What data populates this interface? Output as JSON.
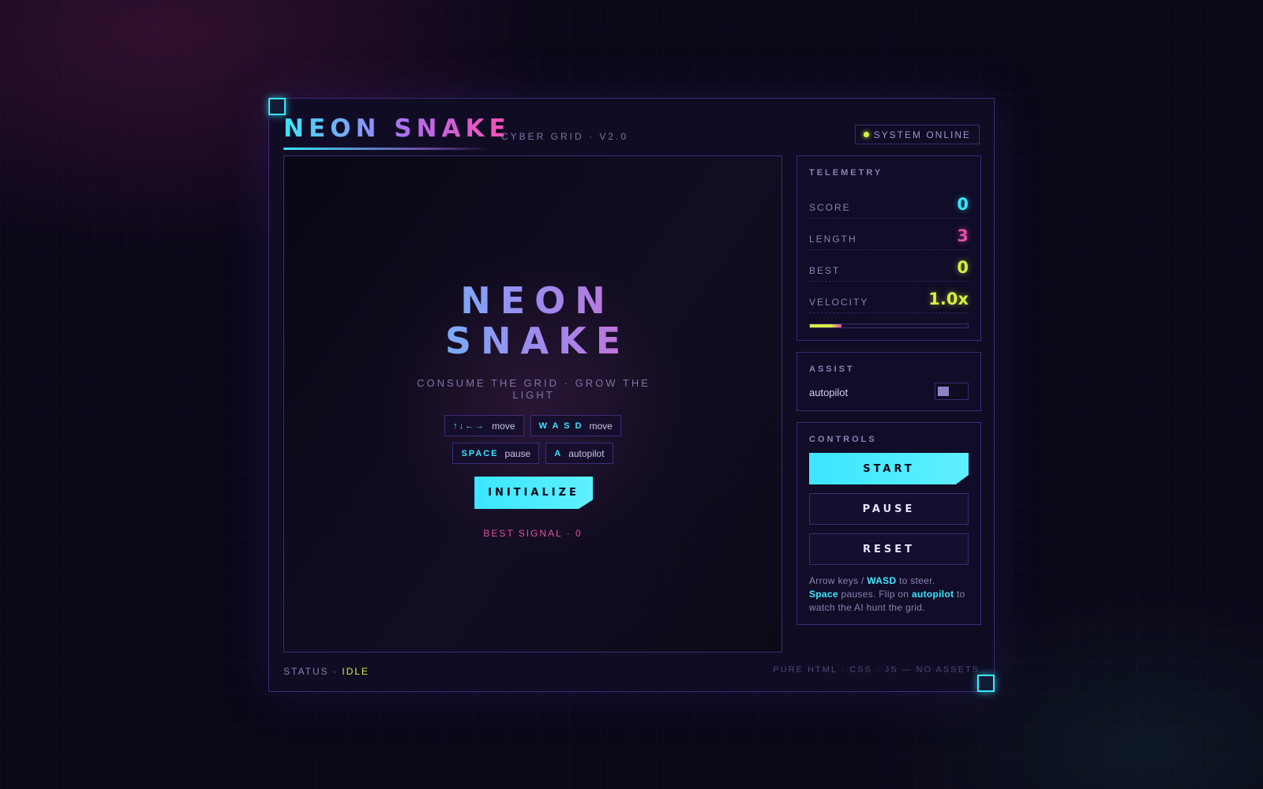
{
  "header": {
    "title": "NEON SNAKE",
    "subtitle": "CYBER GRID · V2.0",
    "status_badge": "SYSTEM ONLINE"
  },
  "board": {
    "title_line1": "NEON",
    "title_line2": "SNAKE",
    "tagline": "CONSUME THE GRID · GROW THE LIGHT",
    "key_hints": [
      {
        "key": "↑↓←→",
        "action": "move"
      },
      {
        "key": "W A S D",
        "action": "move"
      },
      {
        "key": "SPACE",
        "action": "pause"
      },
      {
        "key": "A",
        "action": "autopilot"
      }
    ],
    "init_button": "INITIALIZE",
    "best_signal": "BEST SIGNAL · 0"
  },
  "telemetry": {
    "title": "TELEMETRY",
    "stats": [
      {
        "label": "SCORE",
        "value": "0",
        "color": "#3be6ff"
      },
      {
        "label": "LENGTH",
        "value": "3",
        "color": "#e24fa8"
      },
      {
        "label": "BEST",
        "value": "0",
        "color": "#d8f040"
      },
      {
        "label": "VELOCITY",
        "value": "1.0x",
        "color": "#d8f040"
      }
    ],
    "velocity_fraction": 0.2
  },
  "assist": {
    "title": "ASSIST",
    "autopilot_label": "autopilot",
    "autopilot_on": false
  },
  "controls": {
    "title": "CONTROLS",
    "start_label": "START",
    "pause_label": "PAUSE",
    "reset_label": "RESET",
    "help": {
      "p1": "Arrow keys / ",
      "k1": "WASD",
      "p2": " to steer. ",
      "k2": "Space",
      "p3": " pauses. Flip on ",
      "k3": "autopilot",
      "p4": " to watch the AI hunt the grid."
    }
  },
  "footer": {
    "status_prefix": "STATUS · ",
    "status_value": "IDLE",
    "note": "PURE HTML · CSS · JS — NO ASSETS"
  },
  "colors": {
    "accent_cyan": "#3be6ff",
    "accent_pink": "#e24fa8",
    "accent_lime": "#d8f040",
    "border": "#3a2c7a",
    "background": "#0b0818"
  }
}
